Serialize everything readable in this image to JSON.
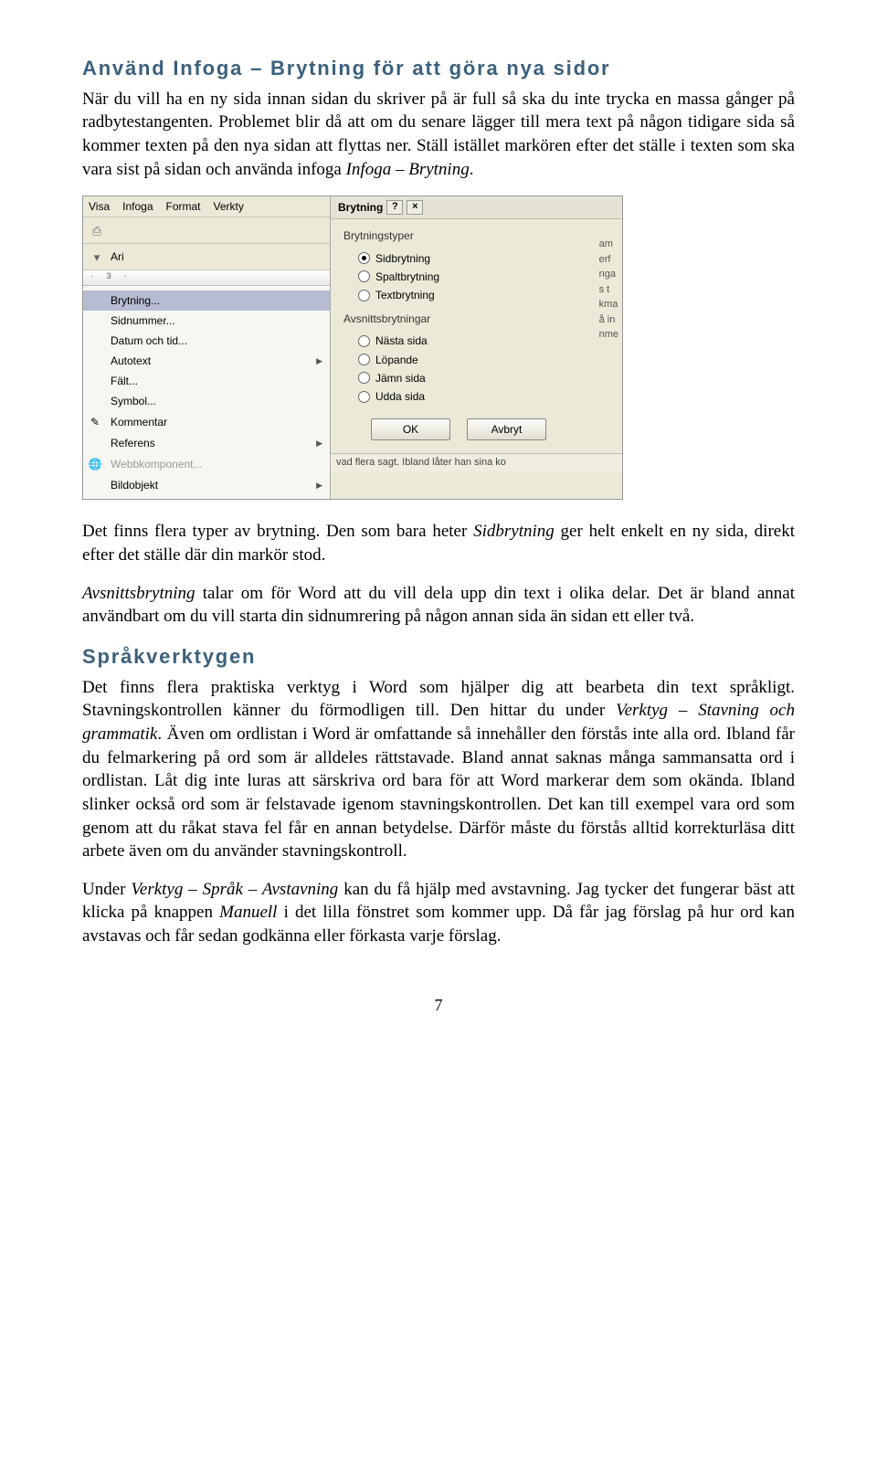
{
  "h1": "Använd Infoga – Brytning för att göra nya sidor",
  "p1": "När du vill ha en ny sida innan sidan du skriver på är full så ska du inte trycka en massa gånger på radbytestangenten. Problemet blir då att om du senare lägger till mera text på någon tidigare sida så kommer texten på den nya sidan att flyttas ner. Ställ istället markören efter det ställe i texten som ska vara sist på sidan och använda infoga ",
  "p1_i": "Infoga – Brytning",
  "p1_end": ".",
  "menubar": {
    "visa": "Visa",
    "infoga": "Infoga",
    "format": "Format",
    "verkty": "Verkty"
  },
  "font_field": "Ari",
  "ruler_marks": "· 3 ·",
  "menu": {
    "brytning": "Brytning...",
    "sidnummer": "Sidnummer...",
    "datum": "Datum och tid...",
    "autotext": "Autotext",
    "falt": "Fält...",
    "symbol": "Symbol...",
    "kommentar": "Kommentar",
    "referens": "Referens",
    "webbkomp": "Webbkomponent...",
    "bildobjekt": "Bildobjekt"
  },
  "dialog": {
    "title": "Brytning",
    "group1": "Brytningstyper",
    "r1": "Sidbrytning",
    "r2": "Spaltbrytning",
    "r3": "Textbrytning",
    "group2": "Avsnittsbrytningar",
    "r4": "Nästa sida",
    "r5": "Löpande",
    "r6": "Jämn sida",
    "r7": "Udda sida",
    "ok": "OK",
    "cancel": "Avbryt"
  },
  "behind": [
    "am",
    "erf",
    "nga",
    "s t",
    "kma",
    "å in",
    "nme"
  ],
  "bottom_strip": "vad flera sagt. Ibland låter han sina ko",
  "p2a": "Det finns flera typer av brytning. Den som bara heter ",
  "p2i": "Sidbrytning",
  "p2b": " ger helt enkelt en ny sida, direkt efter det ställe där din markör stod.",
  "p3i": "Avsnittsbrytning",
  "p3a": " talar om för Word att du vill dela upp din text i olika delar. Det är bland annat användbart om du vill starta din sidnumrering på någon annan sida än sidan ett eller två.",
  "h2": "Språkverktygen",
  "p4a": "Det finns flera praktiska verktyg i Word som hjälper dig att bearbeta din text språkligt. Stavningskontrollen känner du förmodligen till. Den hittar du under ",
  "p4i": "Verktyg – Stavning och grammatik",
  "p4b": ". Även om ordlistan i Word är omfattande så innehåller den förstås inte alla ord. Ibland får du felmarkering på ord som är alldeles rättstavade. Bland annat saknas många sammansatta ord i ordlistan. Låt dig inte luras att särskriva ord bara för att Word markerar dem som okända. Ibland slinker också ord som är felstavade igenom stavningskontrollen. Det kan till exempel vara ord som genom att du råkat stava fel får en annan betydelse. Därför måste du förstås alltid korrekturläsa ditt arbete även om du använder stavningskontroll.",
  "p5a": "Under ",
  "p5i": "Verktyg – Språk – Avstavning",
  "p5b": " kan du få hjälp med avstavning. Jag tycker det fungerar bäst att klicka på knappen ",
  "p5i2": "Manuell",
  "p5c": " i det lilla fönstret som kommer upp. Då får jag förslag på hur ord kan avstavas och får sedan godkänna eller förkasta varje förslag.",
  "page_number": "7"
}
